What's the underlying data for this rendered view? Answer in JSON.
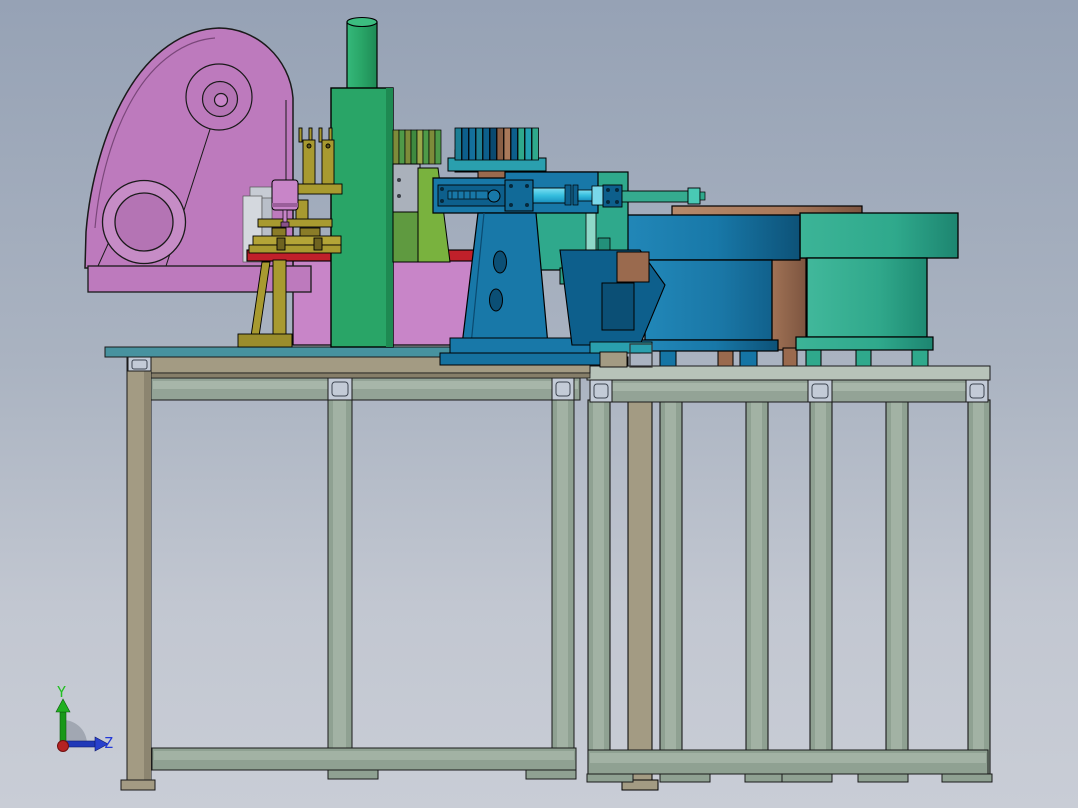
{
  "viewport": {
    "type": "cad-3d-model-view",
    "view_orientation": "side",
    "background_top": "#96a2b5",
    "background_bottom": "#c9cdd6"
  },
  "triad": {
    "y_label": "Y",
    "z_label": "Z",
    "y_color": "#22c022",
    "z_color": "#2238d8",
    "origin_color": "#b62222"
  },
  "palette": {
    "press_frame": "#bd7abd",
    "press_flywheel": "#c68cc6",
    "die_shoe": "#c885c8",
    "die_plate_red": "#c0202a",
    "tooling_gold": "#a89a30",
    "column_green": "#29a567",
    "feeder_blue": "#1878a8",
    "feeder_blue_dark": "#0d5f8c",
    "unit_teal_green": "#2fa98c",
    "actuator_cyan": "#35bede",
    "bowl_brown": "#a9795a",
    "table_top_teal": "#47929f",
    "table_tan": "#a39b83",
    "frame_gray_green": "#8fa192",
    "connector_light": "#c3cbd7",
    "lime_part": "#79b23e",
    "gray_plate": "#aab1bb"
  },
  "parts": [
    {
      "name": "press-frame",
      "color": "#bd7abd"
    },
    {
      "name": "press-flywheel",
      "color": "#c68cc6"
    },
    {
      "name": "press-cylinder",
      "color": "#c885c8"
    },
    {
      "name": "tooling-fixture",
      "color": "#a89a30"
    },
    {
      "name": "die-plate",
      "color": "#c0202a"
    },
    {
      "name": "support-column",
      "color": "#29a567"
    },
    {
      "name": "feed-unit",
      "color": "#1878a8"
    },
    {
      "name": "transfer-unit",
      "color": "#2fa98c"
    },
    {
      "name": "actuator-rod",
      "color": "#35bede"
    },
    {
      "name": "bowl-feeder-front",
      "color": "#1878a8"
    },
    {
      "name": "bowl-feeder-middle",
      "color": "#a9795a"
    },
    {
      "name": "bowl-feeder-right",
      "color": "#2fa98c"
    },
    {
      "name": "workbench-left",
      "color": "#a39b83"
    },
    {
      "name": "workbench-right",
      "color": "#8fa192"
    }
  ]
}
